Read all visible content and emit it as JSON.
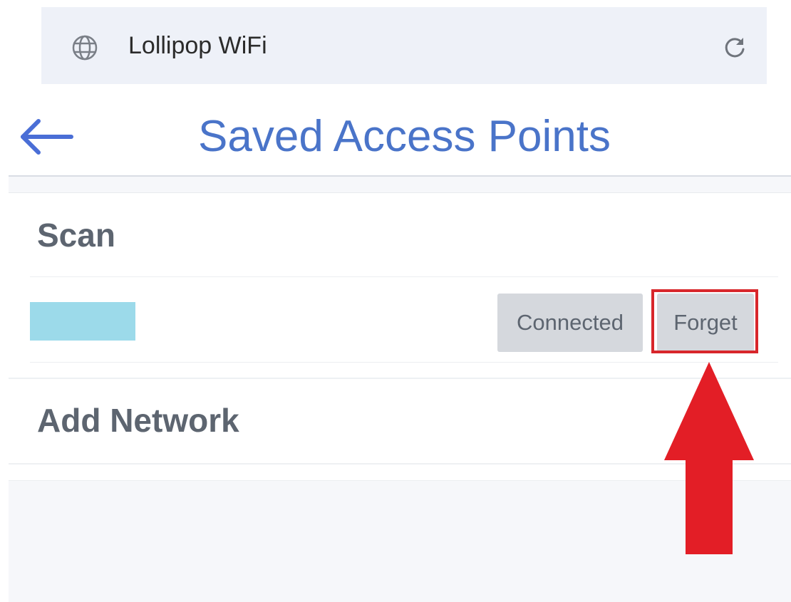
{
  "browser": {
    "site_title": "Lollipop WiFi",
    "left_icon": "globe-icon",
    "right_icon": "reload-icon"
  },
  "header": {
    "back_icon": "arrow-left-icon",
    "title": "Saved Access Points",
    "title_color": "#4a74c9"
  },
  "sections": {
    "scan_label": "Scan",
    "add_network_label": "Add Network"
  },
  "saved_network": {
    "name_redacted": true,
    "redaction_color": "#9cdaea",
    "status_label": "Connected",
    "forget_label": "Forget"
  },
  "annotation": {
    "highlight_color": "#d8262b",
    "arrow_icon": "arrow-up-icon",
    "target": "Forget"
  }
}
